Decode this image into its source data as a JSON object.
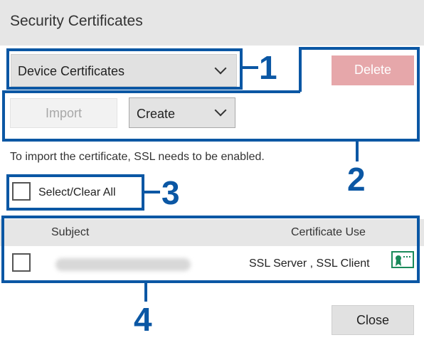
{
  "window": {
    "title": "Security Certificates"
  },
  "certificate_type_select": {
    "value": "Device Certificates"
  },
  "toolbar": {
    "delete_label": "Delete",
    "import_label": "Import",
    "create_value": "Create"
  },
  "hint_text": "To import the certificate, SSL needs to be enabled.",
  "select_all": {
    "label": "Select/Clear All",
    "checked": false
  },
  "table": {
    "columns": [
      "Subject",
      "Certificate Use"
    ],
    "rows": [
      {
        "subject": "",
        "subject_redacted": true,
        "certificate_use": "SSL Server , SSL Client",
        "icon": "certificate-icon",
        "checked": false
      }
    ]
  },
  "footer": {
    "close_label": "Close"
  },
  "callouts": [
    "1",
    "2",
    "3",
    "4"
  ],
  "colors": {
    "callout": "#0b57a4",
    "delete_disabled": "#e6a7aa",
    "title_bar": "#e6e6e6",
    "certificate_icon": "#1a8a5a"
  }
}
